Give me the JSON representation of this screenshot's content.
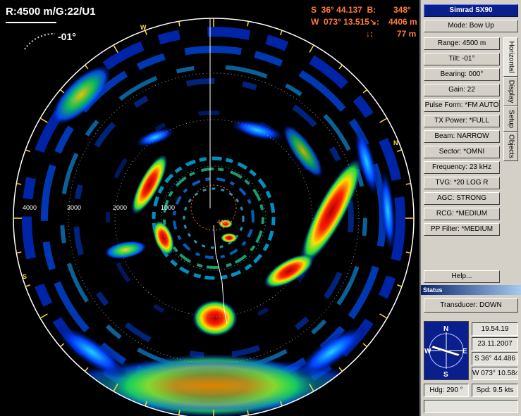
{
  "overlay": {
    "range_gain": "R:4500 m/G:22/U1",
    "tilt": "-01°",
    "lat_line": "S  36° 44.137  B:",
    "bearing_value": "348°",
    "lon_line": "W  073° 13.515",
    "range_value": "4406 m",
    "depth_value": "77 m",
    "center_label": "4406",
    "range_ticks": [
      "4000",
      "3000",
      "2000",
      "1000"
    ],
    "compass_letters": [
      "W",
      "N",
      "S"
    ]
  },
  "panel": {
    "title": "Simrad SX90",
    "mode": "Mode: Bow Up",
    "settings": [
      "Range: 4500 m",
      "Tilt: -01°",
      "Bearing: 000°",
      "Gain: 22",
      "Pulse Form: *FM AUTO",
      "TX Power: *FULL",
      "Beam: NARROW",
      "Sector: *OMNI",
      "Frequency: 23 kHz",
      "TVG: *20 LOG R",
      "AGC: STRONG",
      "RCG: *MEDIUM",
      "PP Filter: *MEDIUM"
    ],
    "help": "Help...",
    "tabs": [
      "Horizontal",
      "Display",
      "Setup",
      "Objects"
    ]
  },
  "status": {
    "header": "Status",
    "transducer": "Transducer: DOWN",
    "time": "19.54.19",
    "date": "23.11.2007",
    "lat": "S  36° 44.486",
    "lon": "W 073° 10.584",
    "heading": "Hdg: 290 °",
    "speed": "Spd: 9.5 kts",
    "compass": [
      "N",
      "E",
      "S",
      "W"
    ]
  }
}
